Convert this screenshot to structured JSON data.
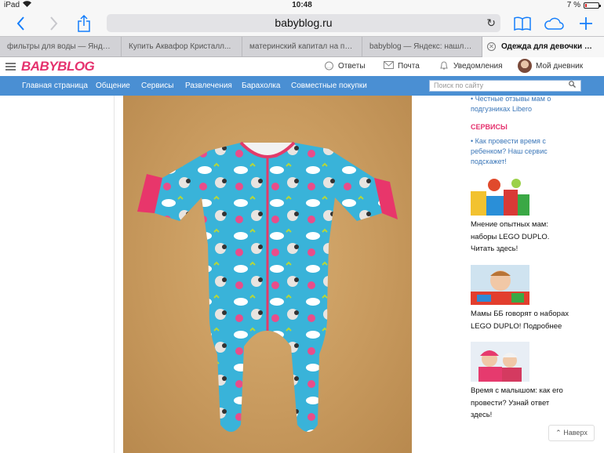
{
  "status": {
    "device": "iPad",
    "time": "10:48",
    "battery": "7 %"
  },
  "toolbar": {
    "url": "babyblog.ru"
  },
  "tabs": [
    "фильтры для воды — Яндекс...",
    "Купить Аквафор Кристалл...",
    "материнский капитал на по...",
    "babyblog — Яндекс: нашло...",
    "Одежда для девочки до..."
  ],
  "header": {
    "logo": "BABYBLOG",
    "answers": "Ответы",
    "mail": "Почта",
    "notifications": "Уведомления",
    "my_diary": "Мой дневник"
  },
  "nav": {
    "items": [
      "Главная страница",
      "Общение",
      "Сервисы",
      "Развлечения",
      "Барахолка",
      "Совместные покупки"
    ],
    "search_placeholder": "Поиск по сайту"
  },
  "sidebar": {
    "top_link": "• Честные отзывы мам о подгузниках Libero",
    "services_heading": "СЕРВИСЫ",
    "services_link": "• Как провести время с ребенком? Наш сервис подскажет!",
    "promos": [
      {
        "caption": "Мнение опытных мам: наборы LEGO DUPLO. Читать здесь!"
      },
      {
        "caption": "Мамы ББ говорят о наборах LEGO DUPLO! Подробнее"
      },
      {
        "caption": "Время с малышом: как его провести? Узнай ответ здесь!"
      }
    ],
    "back_button": "Наверх"
  },
  "colors": {
    "brand": "#e5326e",
    "nav": "#4a8fd3",
    "ios_blue": "#157efb"
  }
}
